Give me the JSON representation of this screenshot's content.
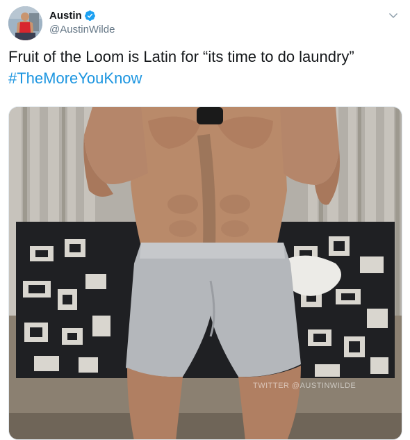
{
  "author": {
    "display_name": "Austin",
    "handle": "@AustinWilde",
    "verified": true,
    "avatar_icon": "profile-photo"
  },
  "tweet": {
    "text_plain": "Fruit of the Loom is Latin for “its time to do laundry”",
    "hashtag": "#TheMoreYouKnow"
  },
  "media": {
    "watermark": "TWITTER @AUSTINWILDE"
  },
  "colors": {
    "link": "#1b95e0",
    "verified": "#1da1f2",
    "secondary_text": "#657786",
    "primary_text": "#14171a"
  },
  "icons": {
    "verified": "verified-badge-icon",
    "more": "chevron-down-icon"
  }
}
